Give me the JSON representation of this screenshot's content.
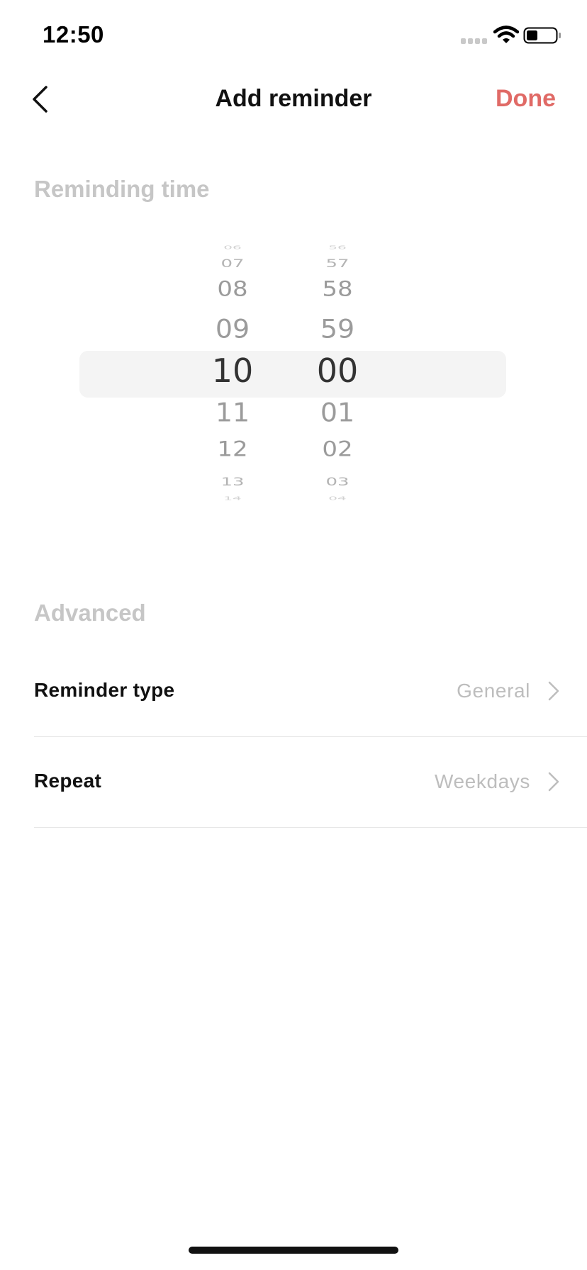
{
  "status_bar": {
    "time": "12:50"
  },
  "nav": {
    "title": "Add reminder",
    "done_label": "Done",
    "accent_color": "#e06a66"
  },
  "sections": {
    "reminding_time": "Reminding time",
    "advanced": "Advanced"
  },
  "time_picker": {
    "selected_hour": "10",
    "selected_minute": "00",
    "hours": [
      "06",
      "07",
      "08",
      "09",
      "10",
      "11",
      "12",
      "13",
      "14"
    ],
    "minutes": [
      "56",
      "57",
      "58",
      "59",
      "00",
      "01",
      "02",
      "03",
      "04"
    ]
  },
  "rows": [
    {
      "label": "Reminder type",
      "value": "General"
    },
    {
      "label": "Repeat",
      "value": "Weekdays"
    }
  ]
}
